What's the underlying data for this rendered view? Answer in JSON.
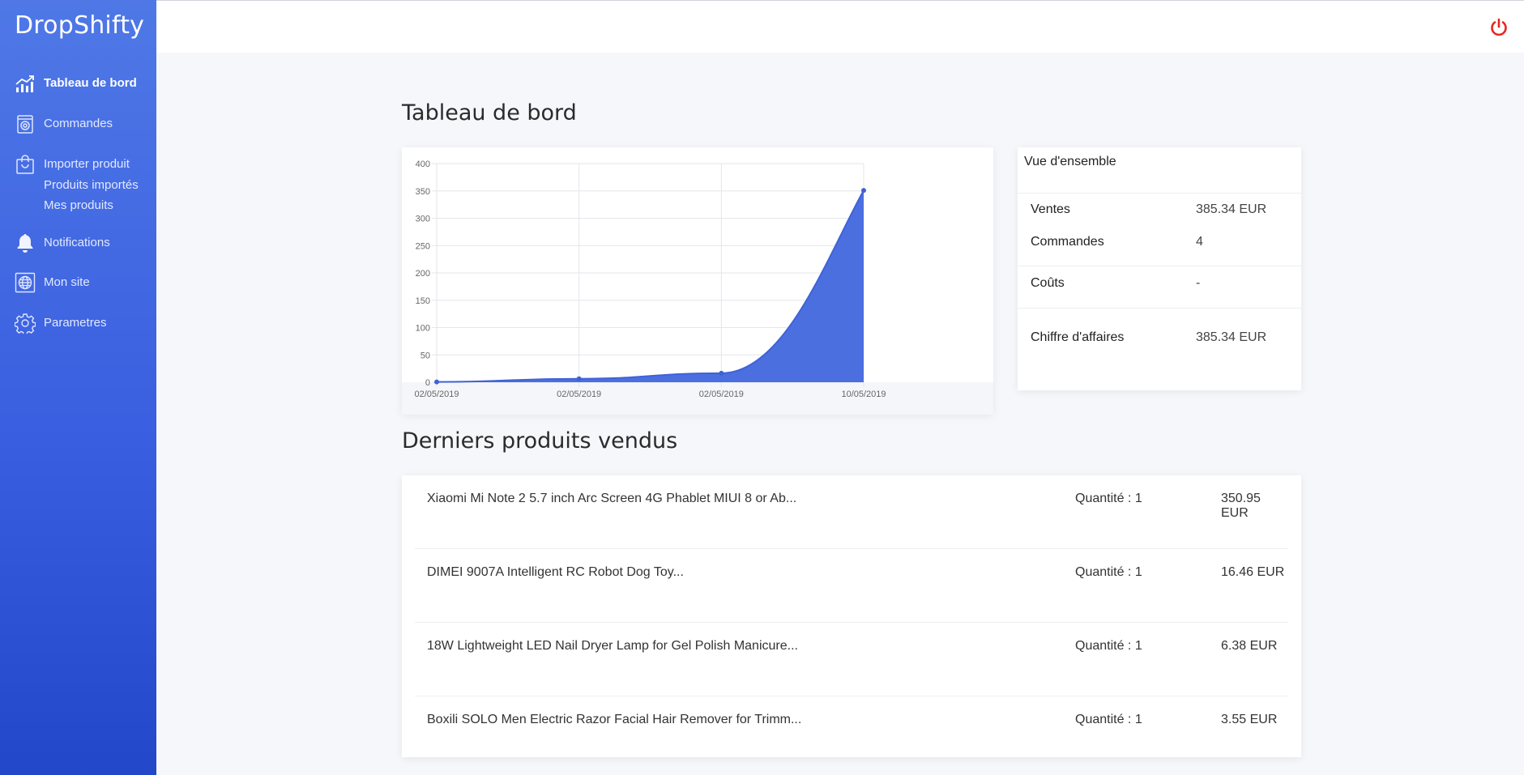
{
  "app": {
    "brand": "DropShifty"
  },
  "sidebar": {
    "items": [
      {
        "label": "Tableau de bord",
        "icon": "chart-growth-icon",
        "active": true
      },
      {
        "label": "Commandes",
        "icon": "orders-icon"
      },
      {
        "label": "Importer produit",
        "icon": "shopping-bag-icon",
        "subs": [
          "Produits importés",
          "Mes produits"
        ]
      },
      {
        "label": "Notifications",
        "icon": "bell-icon"
      },
      {
        "label": "Mon site",
        "icon": "globe-icon"
      },
      {
        "label": "Parametres",
        "icon": "gear-icon"
      }
    ]
  },
  "topbar": {
    "logout_icon": "power-icon",
    "logout_color": "#e8261e"
  },
  "page": {
    "title": "Tableau de bord",
    "section_products_title": "Derniers produits vendus"
  },
  "chart_data": {
    "type": "area",
    "title": "",
    "xlabel": "",
    "ylabel": "",
    "x": [
      "02/05/2019",
      "02/05/2019",
      "02/05/2019",
      "10/05/2019"
    ],
    "series": [
      {
        "values": [
          0.5,
          6.38,
          16.46,
          350.95
        ],
        "color": "#4c6fe0"
      }
    ],
    "ylim": [
      0,
      400
    ],
    "yticks": [
      0,
      50,
      100,
      150,
      200,
      250,
      300,
      350,
      400
    ],
    "grid": true,
    "legend": "none"
  },
  "overview": {
    "title": "Vue d'ensemble",
    "rows": [
      {
        "label": "Ventes",
        "value": "385.34 EUR"
      },
      {
        "label": "Commandes",
        "value": "4"
      },
      {
        "label": "Coûts",
        "value": "-"
      },
      {
        "label": "Chiffre d'affaires",
        "value": "385.34 EUR"
      }
    ]
  },
  "products": [
    {
      "name": "Xiaomi Mi Note 2 5.7 inch Arc Screen 4G Phablet MIUI 8 or Ab...",
      "qty": "Quantité : 1",
      "price": "350.95 EUR"
    },
    {
      "name": "DIMEI 9007A Intelligent RC Robot Dog Toy...",
      "qty": "Quantité : 1",
      "price": "16.46 EUR"
    },
    {
      "name": "18W Lightweight LED Nail Dryer Lamp for Gel Polish Manicure...",
      "qty": "Quantité : 1",
      "price": "6.38 EUR"
    },
    {
      "name": "Boxili SOLO Men Electric Razor Facial Hair Remover for Trimm...",
      "qty": "Quantité : 1",
      "price": "3.55 EUR"
    }
  ]
}
